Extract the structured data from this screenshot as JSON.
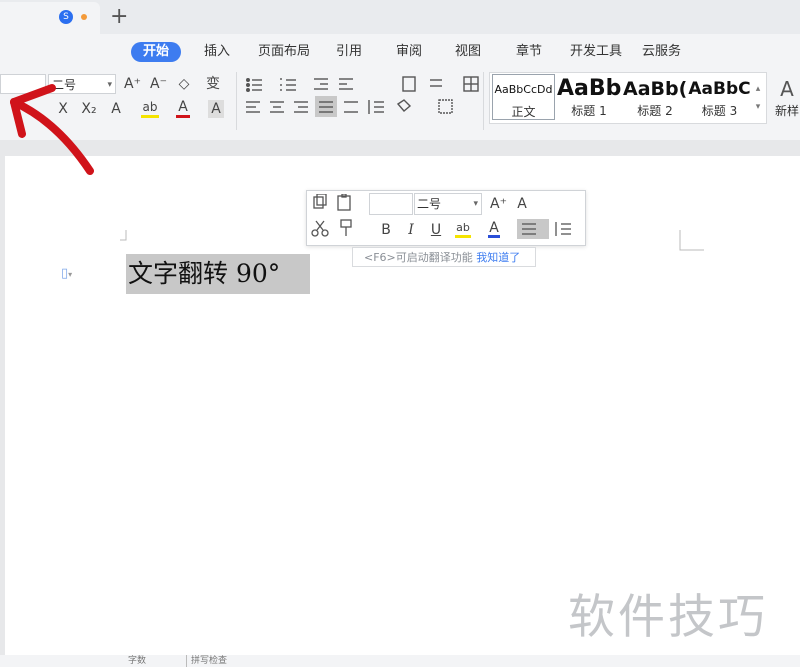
{
  "tabbar": {
    "doc_badge": "S",
    "new_tab": "+"
  },
  "menu": [
    "开始",
    "插入",
    "页面布局",
    "引用",
    "审阅",
    "视图",
    "章节",
    "开发工具",
    "云服务"
  ],
  "ribbon": {
    "font_size": "二号",
    "styles": [
      {
        "preview": "AaBbCcDd",
        "label": "正文"
      },
      {
        "preview": "AaBb",
        "label": "标题 1"
      },
      {
        "preview": "AaBb(",
        "label": "标题 2"
      },
      {
        "preview": "AaBbC",
        "label": "标题 3"
      },
      {
        "preview": "A",
        "label": "新样"
      }
    ],
    "icons": {
      "grow": "A⁺",
      "shrink": "A⁻",
      "clear": "◇",
      "phonetic": "变",
      "strike": "X",
      "sub": "X₂",
      "effect": "A",
      "highlight": "ab",
      "color": "A",
      "charbox": "A"
    }
  },
  "document": {
    "selected_text": "文字翻转 90°"
  },
  "mini_toolbar": {
    "font_size": "二号",
    "tip_text": "<F6>可启动翻译功能",
    "tip_link": "我知道了",
    "bold": "B",
    "italic": "I",
    "underline": "U",
    "grow": "A⁺",
    "shrink": "A"
  },
  "watermark": "软件技巧",
  "statusbar": {
    "words_label": "字数",
    "check_label": "拼写检查"
  },
  "colors": {
    "accent": "#3d7cf0",
    "arrow": "#d0131a"
  }
}
